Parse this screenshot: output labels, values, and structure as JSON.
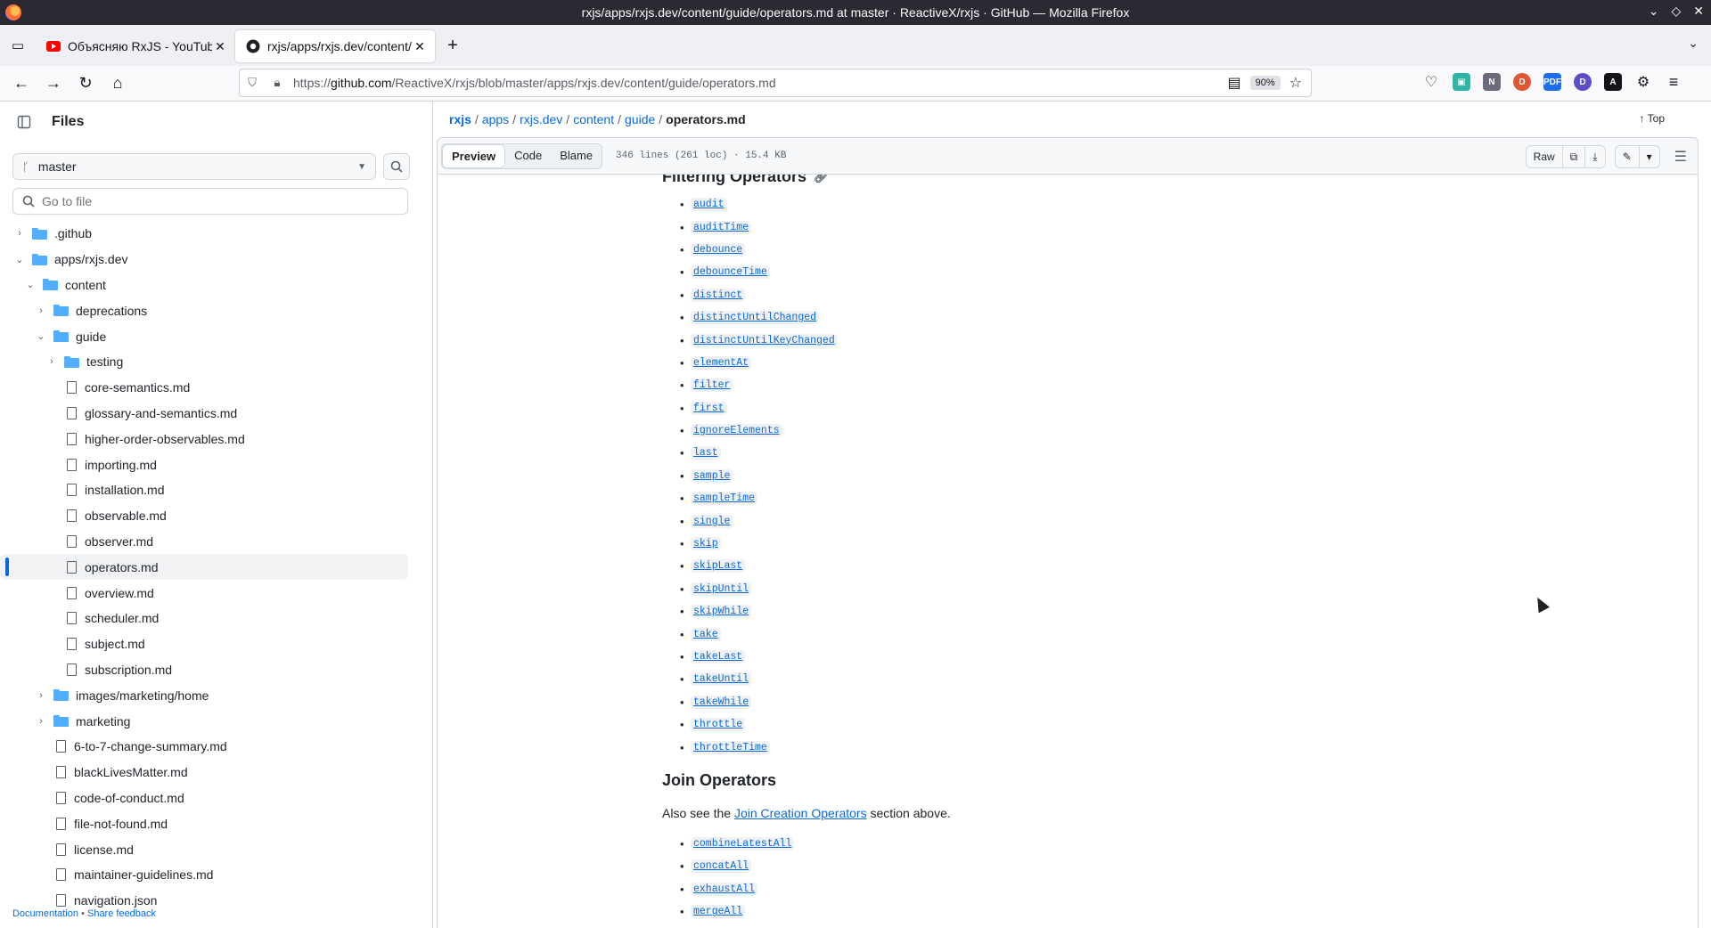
{
  "window": {
    "title": "rxjs/apps/rxjs.dev/content/guide/operators.md at master · ReactiveX/rxjs · GitHub — Mozilla Firefox"
  },
  "tabs": [
    {
      "title": "Объясняю RxJS - YouTube",
      "icon": "youtube-icon"
    },
    {
      "title": "rxjs/apps/rxjs.dev/content/",
      "icon": "github-icon"
    }
  ],
  "navbar": {
    "url_prefix": "https://",
    "url_host": "github.com",
    "url_path": "/ReactiveX/rxjs/blob/master/apps/rxjs.dev/content/guide/operators.md",
    "zoom": "90%"
  },
  "sidebar": {
    "title": "Files",
    "branch": "master",
    "goto_placeholder": "Go to file",
    "items": [
      {
        "label": ".github",
        "type": "folder",
        "depth": 0,
        "expanded": false
      },
      {
        "label": "apps/rxjs.dev",
        "type": "folder",
        "depth": 0,
        "expanded": true
      },
      {
        "label": "content",
        "type": "folder",
        "depth": 1,
        "expanded": true
      },
      {
        "label": "deprecations",
        "type": "folder",
        "depth": 2,
        "expanded": false
      },
      {
        "label": "guide",
        "type": "folder",
        "depth": 2,
        "expanded": true
      },
      {
        "label": "testing",
        "type": "folder",
        "depth": 3,
        "expanded": false
      },
      {
        "label": "core-semantics.md",
        "type": "file",
        "depth": 3
      },
      {
        "label": "glossary-and-semantics.md",
        "type": "file",
        "depth": 3
      },
      {
        "label": "higher-order-observables.md",
        "type": "file",
        "depth": 3
      },
      {
        "label": "importing.md",
        "type": "file",
        "depth": 3
      },
      {
        "label": "installation.md",
        "type": "file",
        "depth": 3
      },
      {
        "label": "observable.md",
        "type": "file",
        "depth": 3
      },
      {
        "label": "observer.md",
        "type": "file",
        "depth": 3
      },
      {
        "label": "operators.md",
        "type": "file",
        "depth": 3,
        "selected": true
      },
      {
        "label": "overview.md",
        "type": "file",
        "depth": 3
      },
      {
        "label": "scheduler.md",
        "type": "file",
        "depth": 3
      },
      {
        "label": "subject.md",
        "type": "file",
        "depth": 3
      },
      {
        "label": "subscription.md",
        "type": "file",
        "depth": 3
      },
      {
        "label": "images/marketing/home",
        "type": "folder",
        "depth": 2,
        "expanded": false
      },
      {
        "label": "marketing",
        "type": "folder",
        "depth": 2,
        "expanded": false
      },
      {
        "label": "6-to-7-change-summary.md",
        "type": "file",
        "depth": 2
      },
      {
        "label": "blackLivesMatter.md",
        "type": "file",
        "depth": 2
      },
      {
        "label": "code-of-conduct.md",
        "type": "file",
        "depth": 2
      },
      {
        "label": "file-not-found.md",
        "type": "file",
        "depth": 2
      },
      {
        "label": "license.md",
        "type": "file",
        "depth": 2
      },
      {
        "label": "maintainer-guidelines.md",
        "type": "file",
        "depth": 2
      },
      {
        "label": "navigation.json",
        "type": "file",
        "depth": 2
      }
    ],
    "footer_docs": "Documentation",
    "footer_sep": "•",
    "footer_feedback": "Share feedback"
  },
  "breadcrumb": [
    "rxjs",
    "apps",
    "rxjs.dev",
    "content",
    "guide"
  ],
  "breadcrumb_current": "operators.md",
  "top_link": "Top",
  "file_header": {
    "tabs": [
      "Preview",
      "Code",
      "Blame"
    ],
    "active_tab": "Preview",
    "meta": "346 lines (261 loc) · 15.4 KB",
    "raw_label": "Raw"
  },
  "content": {
    "section1_title": "Filtering Operators",
    "filtering_ops": [
      "audit",
      "auditTime",
      "debounce",
      "debounceTime",
      "distinct",
      "distinctUntilChanged",
      "distinctUntilKeyChanged",
      "elementAt",
      "filter",
      "first",
      "ignoreElements",
      "last",
      "sample",
      "sampleTime",
      "single",
      "skip",
      "skipLast",
      "skipUntil",
      "skipWhile",
      "take",
      "takeLast",
      "takeUntil",
      "takeWhile",
      "throttle",
      "throttleTime"
    ],
    "section2_title": "Join Operators",
    "join_note_pre": "Also see the ",
    "join_note_link": "Join Creation Operators",
    "join_note_post": " section above.",
    "join_ops": [
      "combineLatestAll",
      "concatAll",
      "exhaustAll",
      "mergeAll"
    ]
  }
}
